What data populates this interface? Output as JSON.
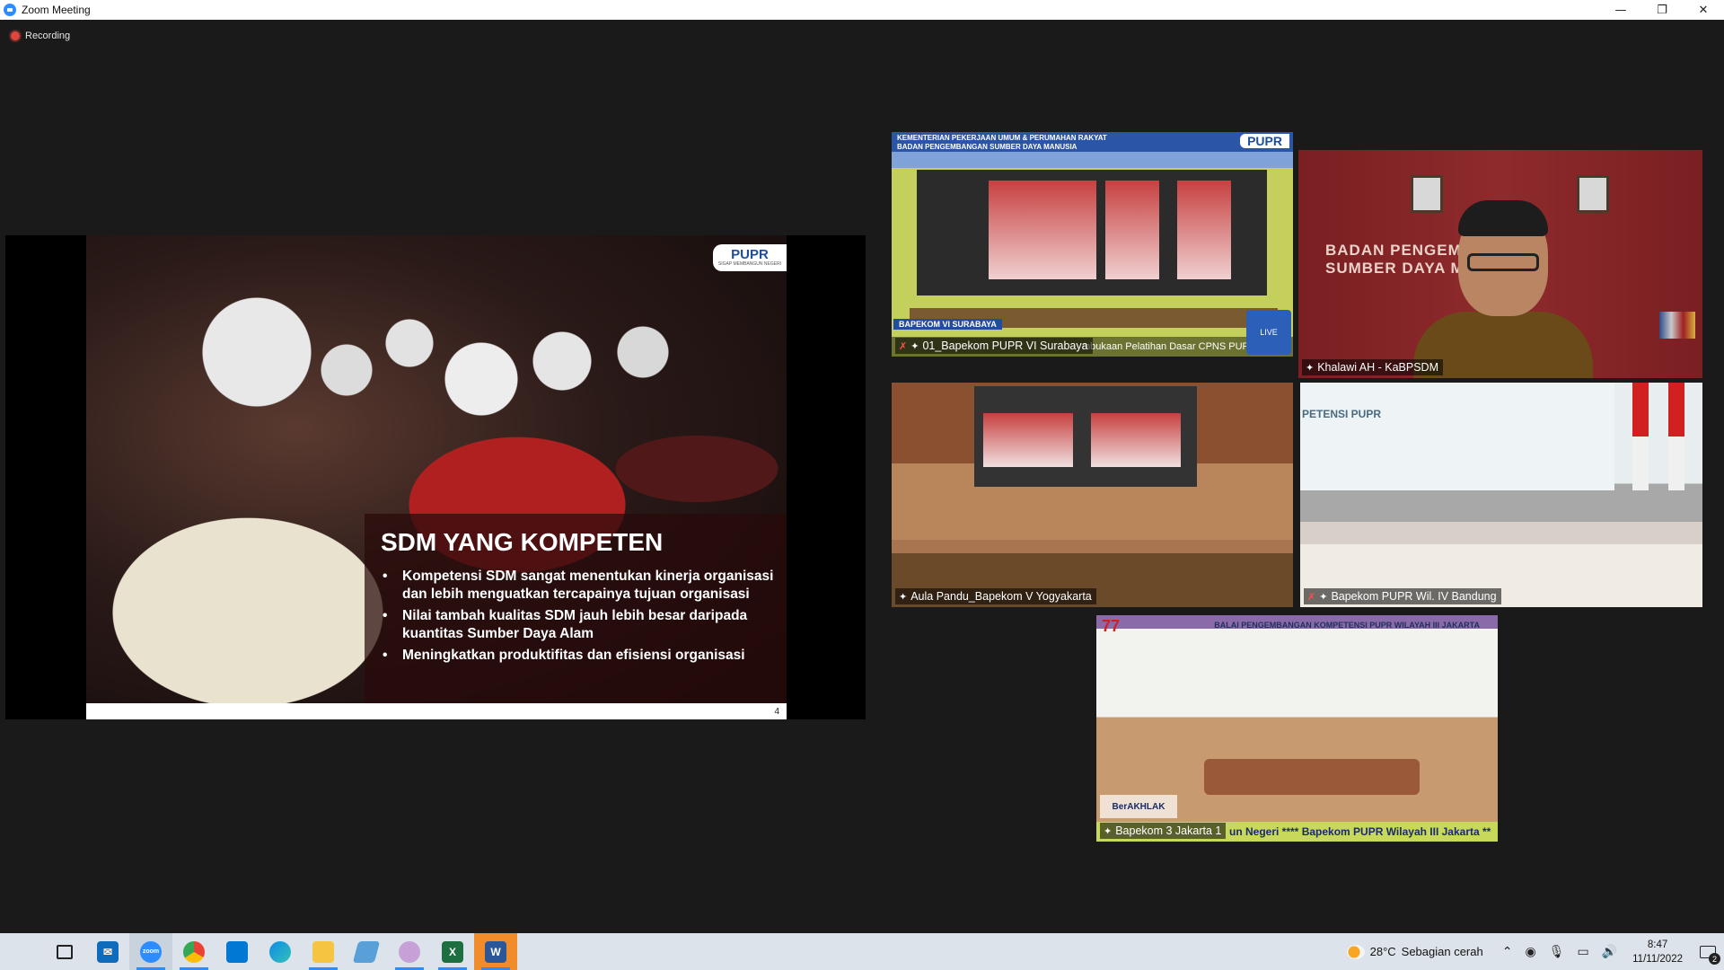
{
  "window": {
    "title": "Zoom Meeting",
    "controls": {
      "minimize": "—",
      "restore": "❐",
      "close": "✕"
    }
  },
  "meeting": {
    "recording_label": "Recording"
  },
  "shared_slide": {
    "logo": "PUPR",
    "logo_sub": "SIGAP MEMBANGUN NEGERI",
    "title": "SDM YANG KOMPETEN",
    "bullets": [
      "Kompetensi SDM sangat menentukan kinerja organisasi dan lebih menguatkan tercapainya tujuan organisasi",
      "Nilai tambah kualitas SDM jauh lebih besar daripada kuantitas Sumber Daya Alam",
      "Meningkatkan produktifitas dan efisiensi organisasi"
    ],
    "page_number": "4"
  },
  "tiles": [
    {
      "name": "01_Bapekom PUPR VI Surabaya",
      "muted": true,
      "pinned": true,
      "overlay": {
        "header1": "KEMENTERIAN PEKERJAAN UMUM & PERUMAHAN RAKYAT",
        "header2": "BADAN PENGEMBANGAN SUMBER DAYA MANUSIA",
        "logo": "PUPR",
        "location": "BAPEKOM VI SURABAYA",
        "ticker": "mbukaan Pelatihan Dasar CPNS PUPR",
        "live": "LIVE"
      }
    },
    {
      "name": "Khalawi AH - KaBPSDM",
      "muted": false,
      "pinned": true,
      "active_speaker": true,
      "wall_text_line1": "BADAN PENGEMBANGAN",
      "wall_text_line2": "SUMBER DAYA MANUSIA"
    },
    {
      "name": "Aula Pandu_Bapekom V Yogyakarta",
      "muted": false,
      "pinned": true
    },
    {
      "name": "Bapekom PUPR Wil. IV Bandung",
      "muted": true,
      "pinned": true,
      "slide_text": "PETENSI PUPR"
    },
    {
      "name": "Bapekom 3 Jakarta 1",
      "muted": false,
      "pinned": true,
      "header_text": "BALAI PENGEMBANGAN KOMPETENSI PUPR WILAYAH III JAKARTA",
      "ticker": "un Negeri **** Bapekom PUPR Wilayah III Jakarta **",
      "side_logo": "BerAKHLAK"
    }
  ],
  "taskbar": {
    "apps": [
      {
        "name": "start",
        "label": ""
      },
      {
        "name": "task-view",
        "label": ""
      },
      {
        "name": "mail",
        "label": ""
      },
      {
        "name": "zoom",
        "label": "zoom",
        "color": "#2d8cff",
        "active": true
      },
      {
        "name": "chrome",
        "label": "",
        "color": "#34a853"
      },
      {
        "name": "store",
        "label": "",
        "color": "#0078d4"
      },
      {
        "name": "edge",
        "label": "",
        "color": "#0c8ce9"
      },
      {
        "name": "file-explorer",
        "label": "",
        "color": "#f5c542"
      },
      {
        "name": "app-blue",
        "label": "",
        "color": "#5aa0d8"
      },
      {
        "name": "snipping",
        "label": "",
        "color": "#c8a0d8"
      },
      {
        "name": "excel",
        "label": "X",
        "color": "#1d6f42"
      },
      {
        "name": "word",
        "label": "W",
        "color": "#2b579a"
      }
    ],
    "weather": {
      "temp": "28°C",
      "condition": "Sebagian cerah"
    },
    "clock": {
      "time": "8:47",
      "date": "11/11/2022"
    },
    "notifications": "2"
  }
}
